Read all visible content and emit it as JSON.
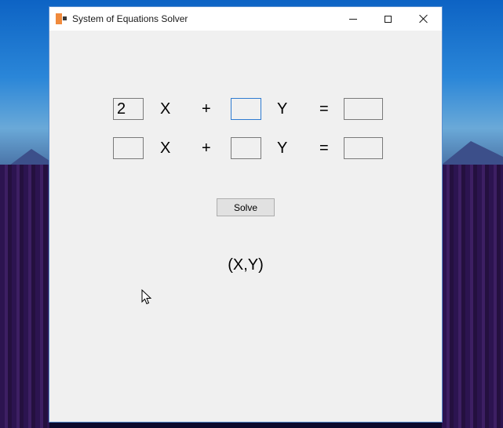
{
  "window": {
    "title": "System of Equations Solver"
  },
  "equations": [
    {
      "a": "2",
      "x_label": "X",
      "plus": "+",
      "b": "",
      "y_label": "Y",
      "equals": "=",
      "c": ""
    },
    {
      "a": "",
      "x_label": "X",
      "plus": "+",
      "b": "",
      "y_label": "Y",
      "equals": "=",
      "c": ""
    }
  ],
  "solve_button": {
    "label": "Solve"
  },
  "result": {
    "text": "(X,Y)"
  },
  "icons": [
    "app-icon",
    "minimize-icon",
    "maximize-icon",
    "close-icon",
    "mouse-pointer-icon"
  ],
  "colors": {
    "focus_border": "#2f7bd1",
    "window_bg": "#f0f0f0"
  }
}
